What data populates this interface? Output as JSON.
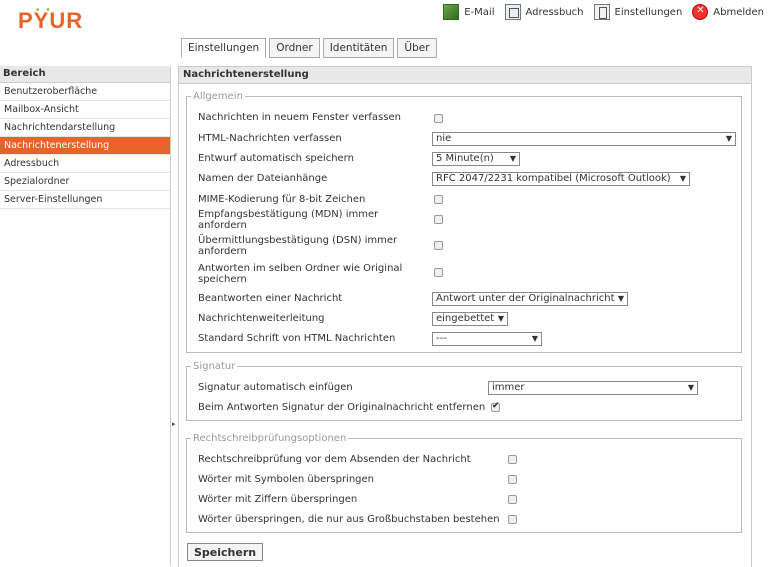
{
  "brand": {
    "logo_text": "PYUR"
  },
  "topnav": [
    {
      "label": "E-Mail",
      "icon": "mail-icon"
    },
    {
      "label": "Adressbuch",
      "icon": "addressbook-icon"
    },
    {
      "label": "Einstellungen",
      "icon": "settings-icon"
    },
    {
      "label": "Abmelden",
      "icon": "logout-icon"
    }
  ],
  "tabs": [
    "Einstellungen",
    "Ordner",
    "Identitäten",
    "Über"
  ],
  "sidebar": {
    "title": "Bereich",
    "items": [
      "Benutzeroberfläche",
      "Mailbox-Ansicht",
      "Nachrichtendarstellung",
      "Nachrichtenerstellung",
      "Adressbuch",
      "Spezialordner",
      "Server-Einstellungen"
    ],
    "active_index": 3
  },
  "main": {
    "title": "Nachrichtenerstellung",
    "allgemein": {
      "legend": "Allgemein",
      "rows": [
        {
          "label": "Nachrichten in neuem Fenster verfassen",
          "type": "checkbox",
          "checked": false
        },
        {
          "label": "HTML-Nachrichten verfassen",
          "type": "select",
          "value": "nie"
        },
        {
          "label": "Entwurf automatisch speichern",
          "type": "select",
          "value": "5 Minute(n)"
        },
        {
          "label": "Namen der Dateianhänge",
          "type": "select",
          "value": "RFC 2047/2231 kompatibel (Microsoft Outlook)"
        },
        {
          "label": "MIME-Kodierung für 8-bit Zeichen",
          "type": "checkbox",
          "checked": false
        },
        {
          "label": "Empfangsbestätigung (MDN) immer anfordern",
          "type": "checkbox",
          "checked": false
        },
        {
          "label": "Übermittlungsbestätigung (DSN) immer anfordern",
          "type": "checkbox",
          "checked": false
        },
        {
          "label": "Antworten im selben Ordner wie Original speichern",
          "type": "checkbox",
          "checked": false
        },
        {
          "label": "Beantworten einer Nachricht",
          "type": "select",
          "value": "Antwort unter der Originalnachricht"
        },
        {
          "label": "Nachrichtenweiterleitung",
          "type": "select",
          "value": "eingebettet"
        },
        {
          "label": "Standard Schrift von HTML Nachrichten",
          "type": "select",
          "value": "---"
        }
      ]
    },
    "signatur": {
      "legend": "Signatur",
      "rows": [
        {
          "label": "Signatur automatisch einfügen",
          "type": "select",
          "value": "immer"
        },
        {
          "label": "Beim Antworten Signatur der Originalnachricht entfernen",
          "type": "checkbox",
          "checked": true
        }
      ]
    },
    "rechtschreib": {
      "legend": "Rechtschreibprüfungsoptionen",
      "rows": [
        {
          "label": "Rechtschreibprüfung vor dem Absenden der Nachricht",
          "type": "checkbox",
          "checked": false
        },
        {
          "label": "Wörter mit Symbolen überspringen",
          "type": "checkbox",
          "checked": false
        },
        {
          "label": "Wörter mit Ziffern überspringen",
          "type": "checkbox",
          "checked": false
        },
        {
          "label": "Wörter überspringen, die nur aus Großbuchstaben bestehen",
          "type": "checkbox",
          "checked": false
        }
      ]
    },
    "save_label": "Speichern"
  },
  "colors": {
    "accent": "#e8632a"
  }
}
